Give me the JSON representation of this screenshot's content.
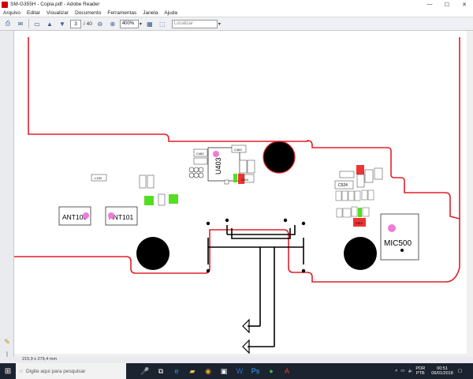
{
  "window": {
    "title": "SM-G355H - Copia.pdf - Adobe Reader",
    "controls": [
      "—",
      "☐",
      "✕"
    ]
  },
  "menu": [
    "Arquivo",
    "Editar",
    "Visualizar",
    "Documento",
    "Ferramentas",
    "Janela",
    "Ajuda"
  ],
  "toolbar": {
    "page_current": "3",
    "page_total": "/ 40",
    "zoom": "400%",
    "search_placeholder": "Localizar"
  },
  "status": {
    "page_size": "215,9 x 279,4 mm"
  },
  "taskbar": {
    "search_placeholder": "Digite aqui para pesquisar",
    "lang_line1": "POR",
    "lang_line2": "PTB",
    "time": "00:51",
    "date": "06/01/2018"
  },
  "schematic": {
    "labels": {
      "u403": "U403",
      "ant100": "ANT100",
      "ant101": "ANT101",
      "mic500": "MIC500",
      "c524": "C524",
      "c463": "C463",
      "c462": "C462",
      "l100": "L100",
      "z404": "Z404",
      "z510": "Z510"
    },
    "colors": {
      "outline": "#e0202a",
      "pad_red": "#ee3333",
      "pad_green": "#55dd22",
      "marker_pink": "#f07ad8",
      "hole": "#000000"
    }
  }
}
